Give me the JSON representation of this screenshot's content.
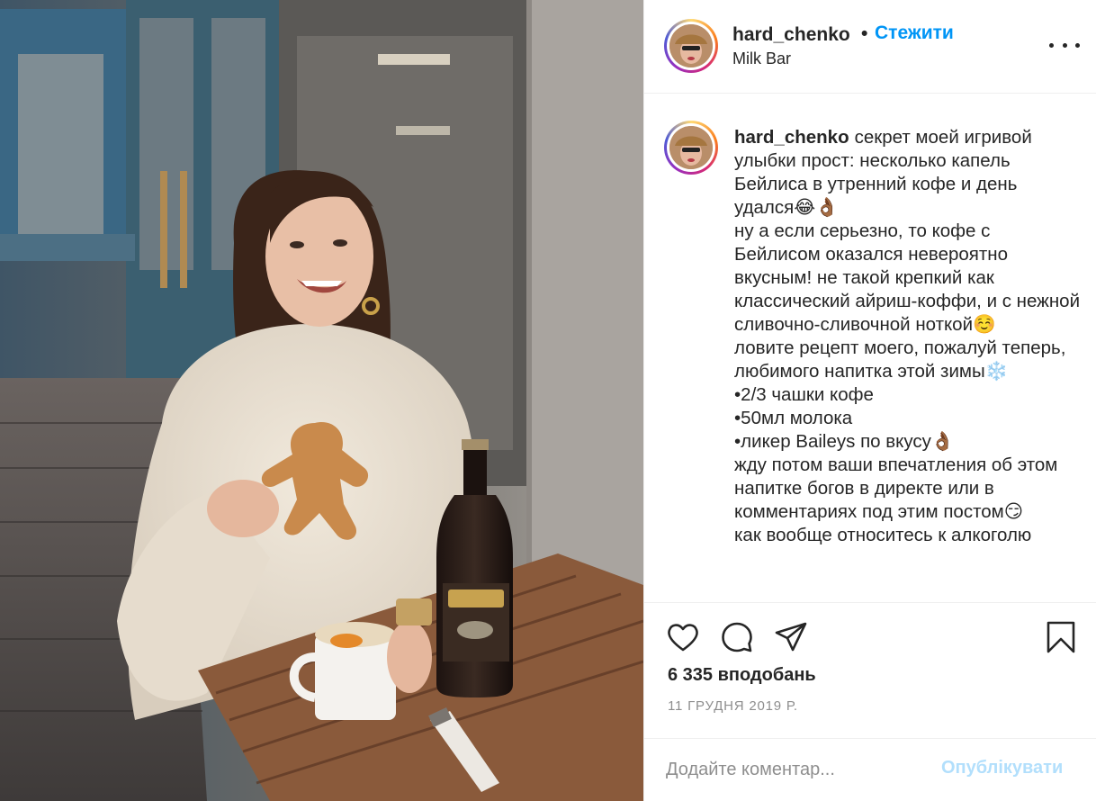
{
  "post": {
    "image_alt": "Photo",
    "header": {
      "username": "hard_chenko",
      "separator": "•",
      "follow_label": "Стежити",
      "location": "Milk Bar"
    },
    "caption": {
      "username": "hard_chenko",
      "text": "секрет моей игривой улыбки прост: несколько капель Бейлиса в утренний кофе и день удался😂👌🏾\nну а если серьезно, то кофе с Бейлисом оказался невероятно вкусным! не такой крепкий как классический айриш-коффи, и с нежной сливочно-сливочной ноткой☺️\nловите рецепт моего, пожалуй теперь, любимого напитка этой зимы❄️\n•2/3 чашки кофе\n•50мл молока\n•ликер Baileys по вкусу👌🏾\nжду потом ваши впечатления об этом напитке богов в директе или в комментариях под этим постом😏\nкак вообще относитесь к алкоголю"
    },
    "likes": "6 335 вподобань",
    "date": "11 ГРУДНЯ 2019 Р.",
    "comment": {
      "placeholder": "Додайте коментар...",
      "value": "",
      "publish_label": "Опублікувати"
    }
  },
  "icons": {
    "like": "heart-icon",
    "comment": "comment-icon",
    "share": "paper-plane-icon",
    "save": "bookmark-icon",
    "more": "more-horizontal-icon"
  },
  "colors": {
    "follow": "#0095f6",
    "publish_disabled": "#b2dffc",
    "muted": "#8e8e8e",
    "text": "#262626"
  }
}
